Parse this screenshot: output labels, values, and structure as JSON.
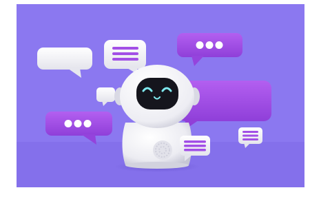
{
  "image": {
    "subject": "robot-assistant-with-speech-bubbles",
    "colors": {
      "background_frame": "#ffffff",
      "backdrop": "#8b78f0",
      "backdrop_floor": "#8570ec",
      "robot_body": "#f1f1f4",
      "robot_shade": "#c9c9d6",
      "robot_face": "#15151d",
      "robot_eyes": "#7ee8ee",
      "bubble_purple": "#a24fe6",
      "bubble_white": "#f5f5f8",
      "bubble_line": "#a24fe6"
    },
    "icons": [
      "robot-icon",
      "speech-bubble-dots-icon",
      "speech-bubble-lines-icon",
      "speech-bubble-empty-icon"
    ]
  }
}
